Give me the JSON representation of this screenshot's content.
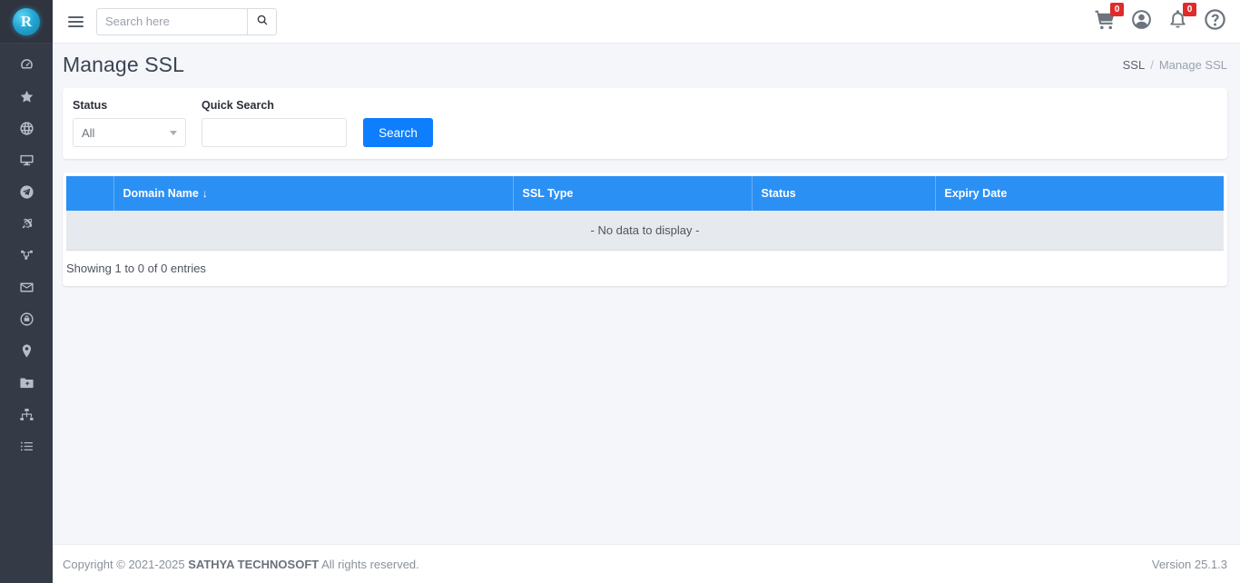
{
  "brand": {
    "logo_letter": "R",
    "accent": "#0d7efd",
    "header_blue": "#2b90f4",
    "sidebar_bg": "#343a46"
  },
  "topbar": {
    "menu_toggle": "menu-toggle",
    "search_placeholder": "Search here",
    "search_value": "",
    "cart_badge": "0",
    "notification_badge": "0"
  },
  "page": {
    "title": "Manage SSL",
    "breadcrumb": {
      "parent": "SSL",
      "separator": "/",
      "current": "Manage SSL"
    }
  },
  "filters": {
    "status": {
      "label": "Status",
      "value": "All",
      "options": [
        "All"
      ]
    },
    "quick_search": {
      "label": "Quick Search",
      "value": "",
      "placeholder": ""
    },
    "search_button": "Search"
  },
  "table": {
    "columns": [
      "",
      "Domain Name",
      "SSL Type",
      "Status",
      "Expiry Date"
    ],
    "sort_column": "Domain Name",
    "sort_direction": "desc",
    "sort_glyph": "↓",
    "empty_message": "- No data to display -",
    "rows": [],
    "entries_info": "Showing 1 to 0 of 0 entries"
  },
  "sidebar": {
    "items": [
      {
        "icon": "dashboard-icon",
        "label": "Dashboard"
      },
      {
        "icon": "star-icon",
        "label": "Favourites"
      },
      {
        "icon": "globe-icon",
        "label": "Domains"
      },
      {
        "icon": "monitor-icon",
        "label": "Hosting"
      },
      {
        "icon": "send-icon",
        "label": "Bulk Mail"
      },
      {
        "icon": "atom-icon",
        "label": "Applications"
      },
      {
        "icon": "sitemap-icon",
        "label": "Network"
      },
      {
        "icon": "envelope-icon",
        "label": "Mail"
      },
      {
        "icon": "lock-shield-icon",
        "label": "SSL"
      },
      {
        "icon": "map-pin-icon",
        "label": "Locations"
      },
      {
        "icon": "folder-plus-icon",
        "label": "Add Files"
      },
      {
        "icon": "org-chart-icon",
        "label": "Organization"
      },
      {
        "icon": "list-icon",
        "label": "Reports"
      }
    ]
  },
  "footer": {
    "copyright_prefix": "Copyright © 2021-2025",
    "company": "SATHYA TECHNOSOFT",
    "copyright_suffix": "All rights reserved.",
    "version": "Version 25.1.3"
  }
}
